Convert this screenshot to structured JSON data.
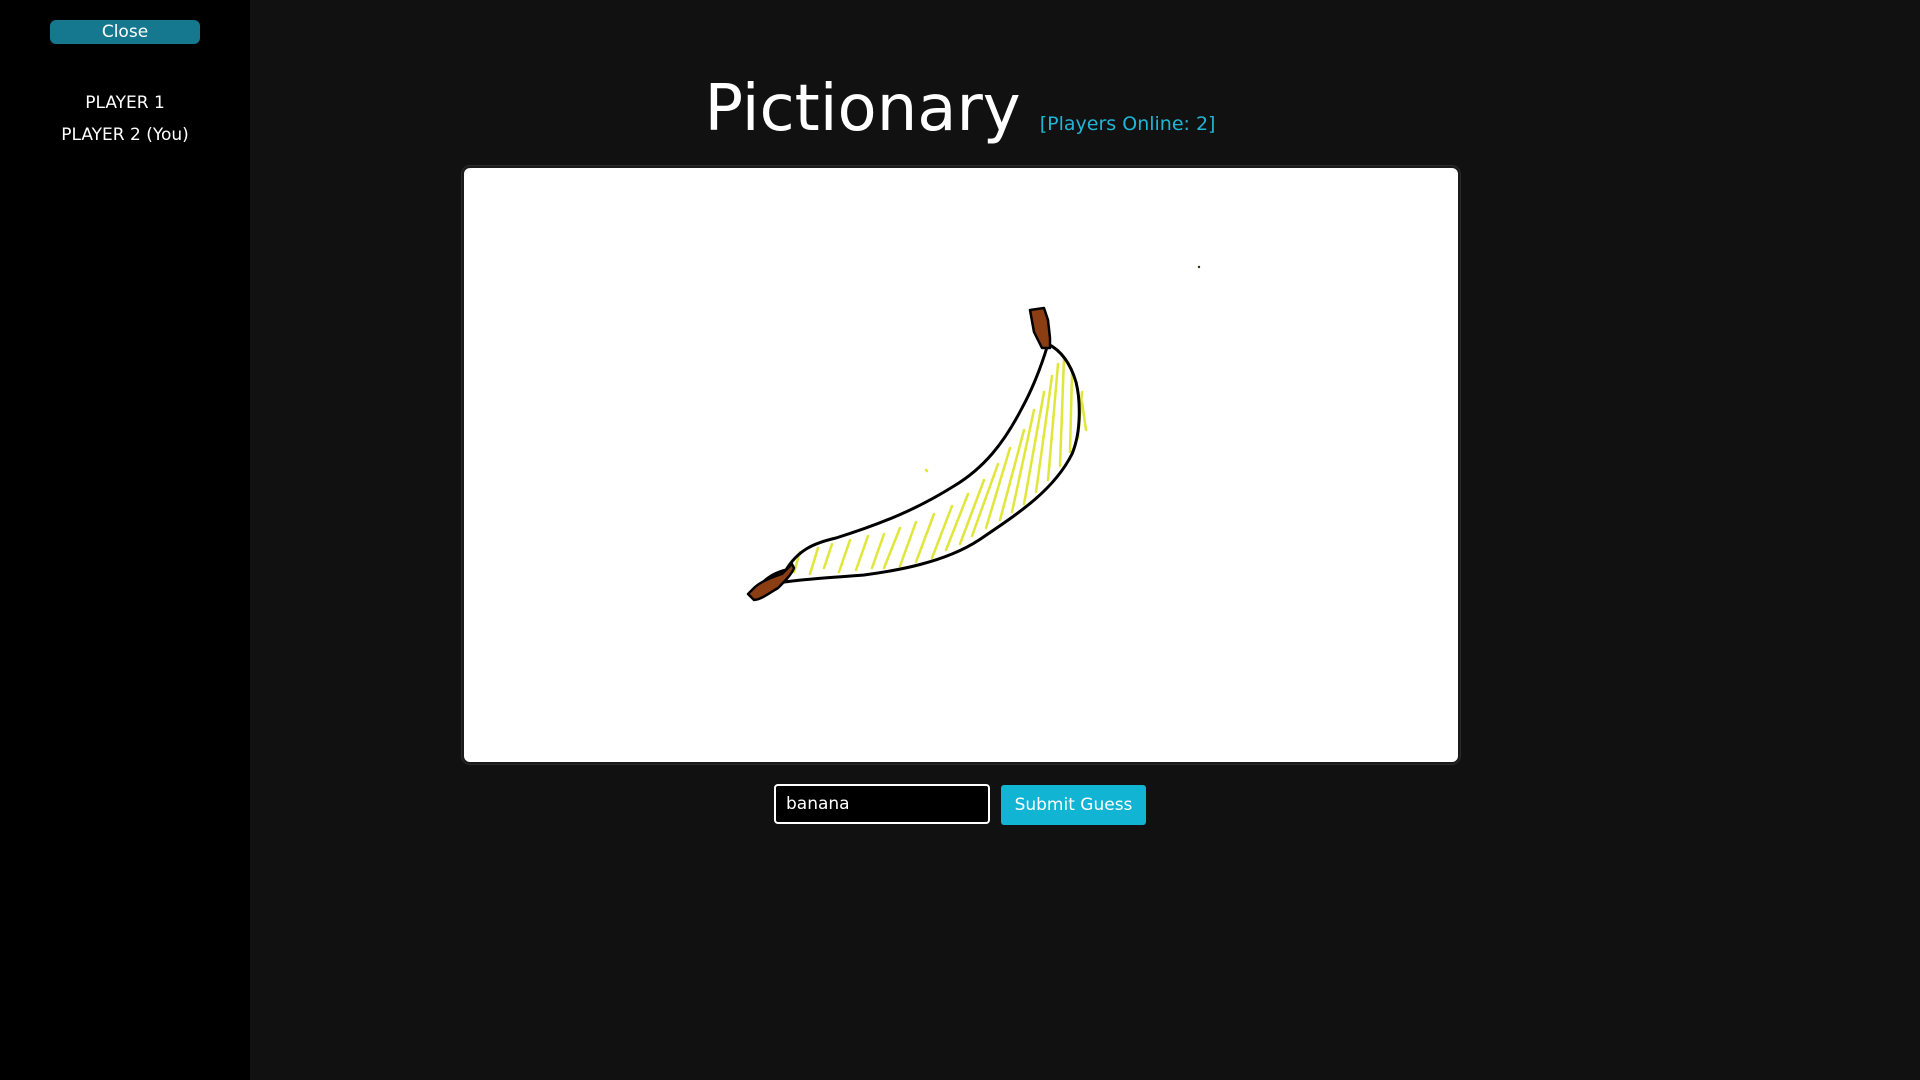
{
  "sidebar": {
    "close_label": "Close",
    "players": [
      {
        "label": "PLAYER 1"
      },
      {
        "label": "PLAYER 2 (You)"
      }
    ]
  },
  "header": {
    "title": "Pictionary",
    "players_online": "[Players Online: 2]"
  },
  "canvas": {
    "drawing": "banana",
    "colors": {
      "outline": "#000000",
      "fill": "#e1e63a",
      "stem": "#8b3e13"
    }
  },
  "guess": {
    "value": "banana",
    "placeholder": "",
    "submit_label": "Submit Guess"
  },
  "colors": {
    "background": "#111111",
    "sidebar": "#000000",
    "close_button": "#16788f",
    "accent": "#12b4d4",
    "online_text": "#1fb6d6"
  }
}
